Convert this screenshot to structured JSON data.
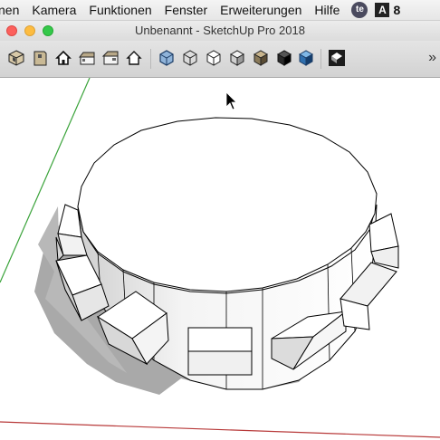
{
  "menubar": {
    "items": [
      "nen",
      "Kamera",
      "Funktionen",
      "Fenster",
      "Erweiterungen",
      "Hilfe"
    ],
    "status_te": "te",
    "status_adobe_logo": "A",
    "status_adobe_count": "8"
  },
  "window": {
    "title": "Unbenannt - SketchUp Pro 2018"
  },
  "toolbar": {
    "overflow_label": "»",
    "tools": [
      "iso-view-icon",
      "top-view-icon",
      "front-view-icon",
      "right-view-icon",
      "back-view-icon",
      "left-view-icon",
      "xray-style-icon",
      "wireframe-style-icon",
      "hidden-line-style-icon",
      "shaded-style-icon",
      "shaded-textures-style-icon",
      "monochrome-style-icon",
      "section-fill-icon",
      "scene-icon"
    ]
  },
  "colors": {
    "green_axis": "#3aa33a",
    "red_axis": "#b83a3a",
    "shadow": "#a8a8a8",
    "edge": "#000000"
  }
}
